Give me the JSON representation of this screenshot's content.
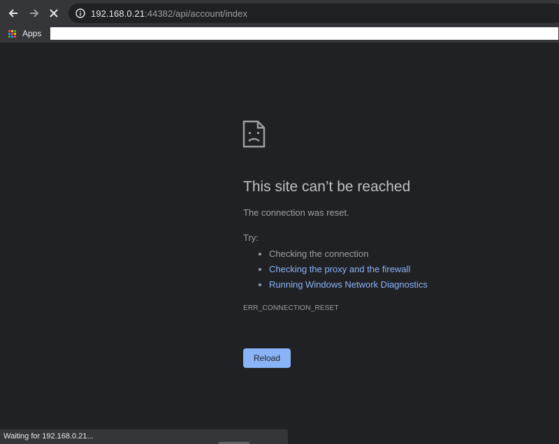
{
  "browser": {
    "url_host": "192.168.0.21",
    "url_path": ":44382/api/account/index",
    "bookmarks": {
      "apps_label": "Apps"
    },
    "status_text": "Waiting for 192.168.0.21..."
  },
  "error_page": {
    "title": "This site can’t be reached",
    "description": "The connection was reset.",
    "try_label": "Try:",
    "suggestions": [
      {
        "label": "Checking the connection",
        "is_link": false
      },
      {
        "label": "Checking the proxy and the firewall",
        "is_link": true
      },
      {
        "label": "Running Windows Network Diagnostics",
        "is_link": true
      }
    ],
    "error_code": "ERR_CONNECTION_RESET",
    "reload_label": "Reload"
  },
  "icons": {
    "back": "arrow-left-icon",
    "forward": "arrow-right-icon",
    "stop": "close-icon",
    "site_info": "info-icon",
    "apps": "apps-grid-icon",
    "error": "sad-document-icon"
  },
  "colors": {
    "page_background": "#202124",
    "toolbar": "#35363a",
    "link": "#8ab4f8",
    "heading": "#bdc1c6",
    "text_muted": "#9aa0a6",
    "button": "#8ab4f8"
  }
}
